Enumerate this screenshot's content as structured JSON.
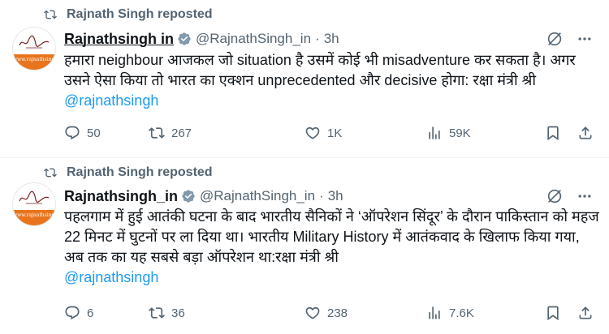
{
  "posts": [
    {
      "reposted_by": "Rajnath Singh reposted",
      "author_name": "Rajnathsingh in",
      "handle": "@RajnathSingh_in",
      "separator": "·",
      "time": "3h",
      "text": "हमारा neighbour आजकल जो situation है उसमें कोई भी misadventure कर सकता है। अगर उसने ऐसा किया तो भारत का एक्शन unprecedented  और decisive होगा: रक्षा मंत्री श्री ",
      "mention": "@rajnathsingh",
      "avatar_caption": "www.rajnathsingh.in",
      "stats": {
        "replies": "50",
        "reposts": "267",
        "likes": "1K",
        "views": "59K"
      }
    },
    {
      "reposted_by": "Rajnath Singh reposted",
      "author_name": "Rajnathsingh_in",
      "handle": "@RajnathSingh_in",
      "separator": "·",
      "time": "3h",
      "text": "पहलगाम में हुई आतंकी घटना के बाद भारतीय सैनिकों ने ‘ऑपरेशन सिंदूर’ के दौरान पाकिस्तान को महज 22 मिनट में घुटनों पर ला दिया था। भारतीय Military History में आतंकवाद के खिलाफ किया गया, अब तक का यह सबसे बड़ा ऑपरेशन था:रक्षा मंत्री श्री ",
      "mention": "@rajnathsingh",
      "avatar_caption": "www.rajnathsingh.in",
      "stats": {
        "replies": "6",
        "reposts": "36",
        "likes": "238",
        "views": "7.6K"
      }
    }
  ],
  "colors": {
    "accent": "#1d9bf0",
    "muted": "#536471",
    "avatar_band": "#e8741c"
  },
  "icons": [
    "repost-icon",
    "verified-badge-icon",
    "grok-icon",
    "more-icon",
    "reply-icon",
    "like-icon",
    "views-icon",
    "bookmark-icon",
    "share-icon"
  ]
}
